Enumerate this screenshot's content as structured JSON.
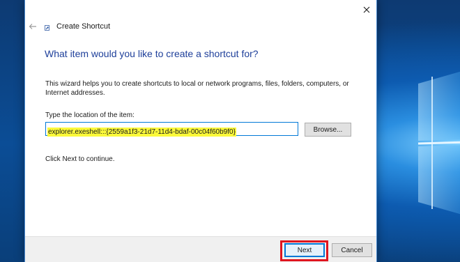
{
  "window": {
    "title": "Create Shortcut",
    "close_icon": "close-icon",
    "back_icon": "back-arrow-icon",
    "app_icon": "shortcut-app-icon"
  },
  "wizard": {
    "heading": "What item would you like to create a shortcut for?",
    "description": "This wizard helps you to create shortcuts to local or network programs, files, folders, computers, or Internet addresses.",
    "location_label": "Type the location of the item:",
    "location_value": "explorer.exeshell:::{2559a1f3-21d7-11d4-bdaf-00c04f60b9f0}",
    "browse_label": "Browse...",
    "continue_text": "Click Next to continue."
  },
  "footer": {
    "next_label": "Next",
    "cancel_label": "Cancel"
  },
  "colors": {
    "heading": "#1e3f9a",
    "input_highlight": "#fbf93a",
    "focus_border": "#0078d7",
    "annotation_box": "#e0141e",
    "desktop": "#0b4d96"
  }
}
